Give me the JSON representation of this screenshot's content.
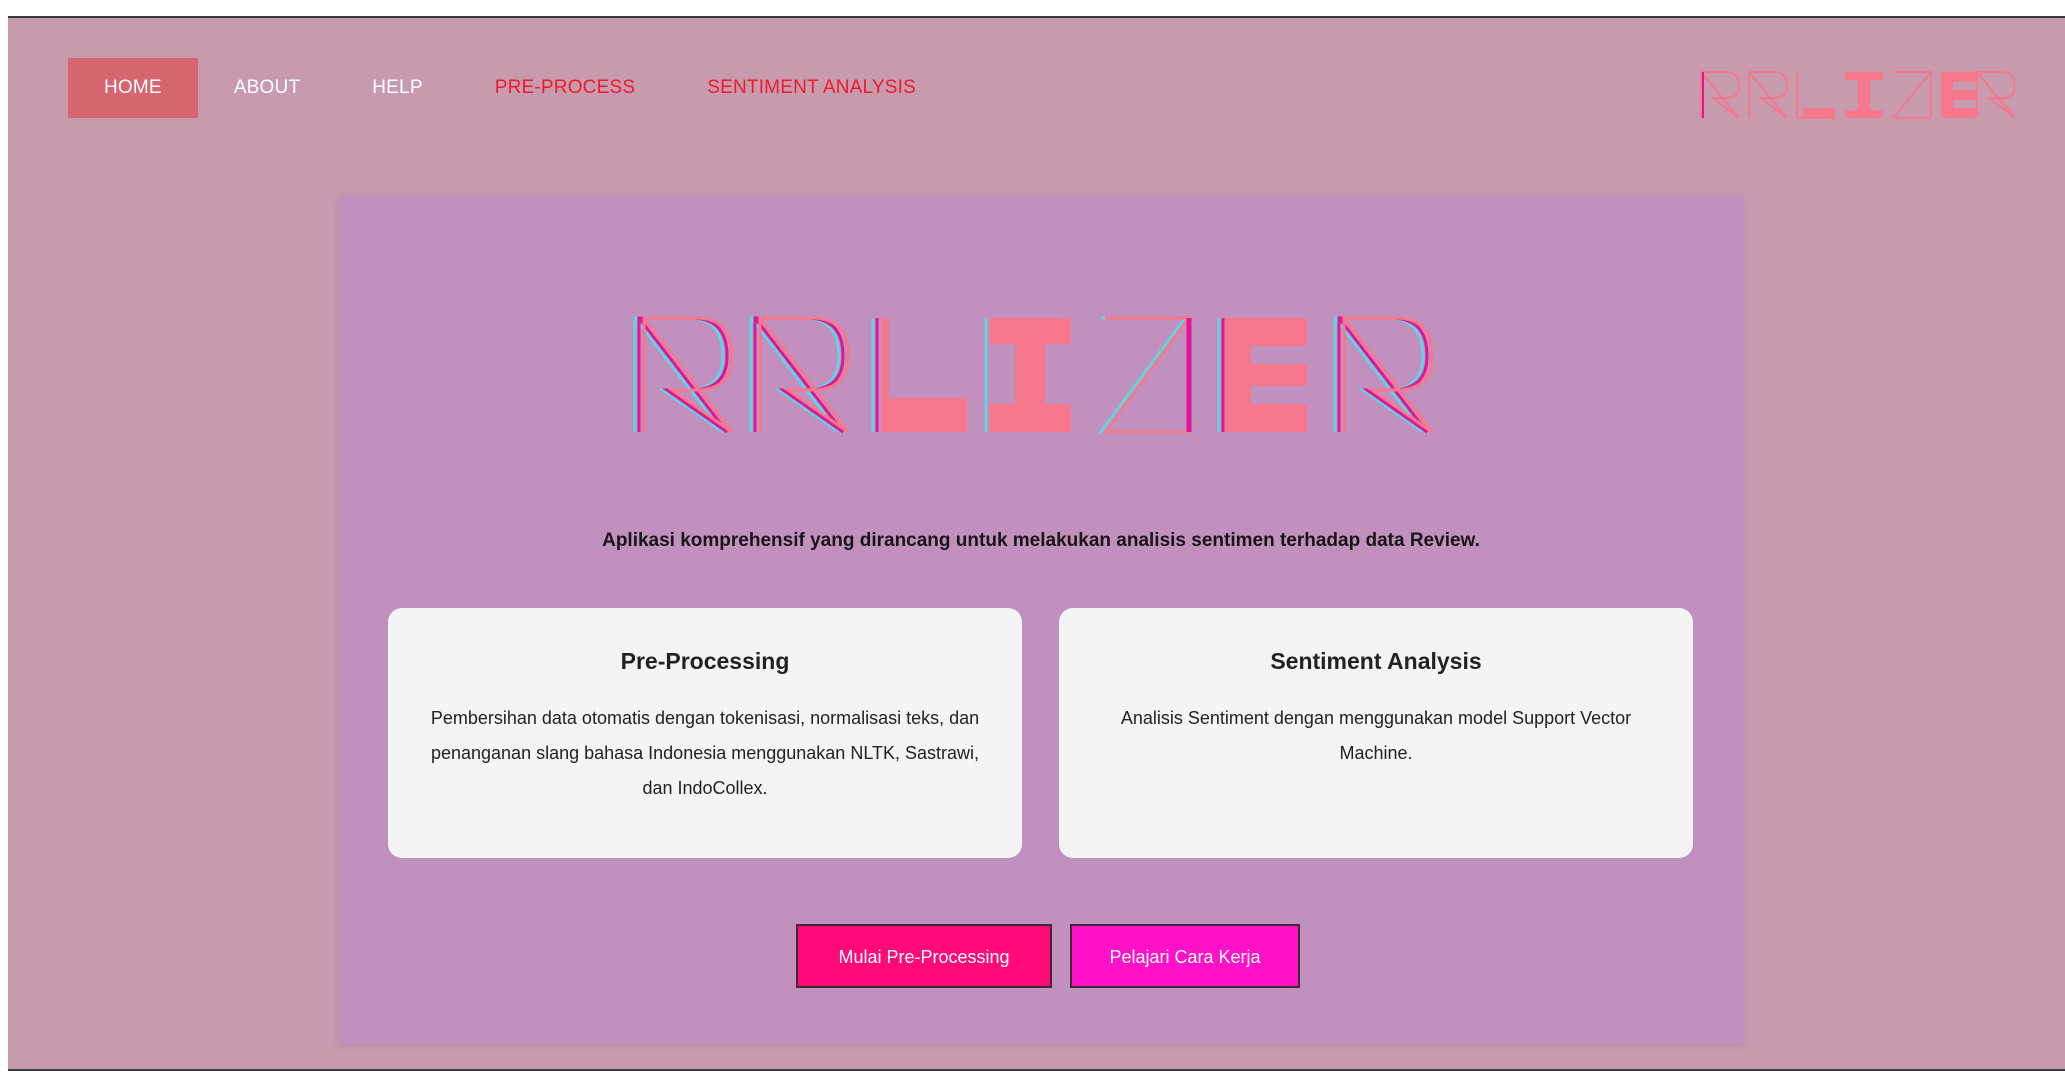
{
  "nav": {
    "items": [
      {
        "label": "HOME",
        "active": true
      },
      {
        "label": "ABOUT",
        "active": false
      },
      {
        "label": "HELP",
        "active": false
      },
      {
        "label": "PRE-PROCESS",
        "active": false
      },
      {
        "label": "SENTIMENT ANALYSIS",
        "active": false
      }
    ]
  },
  "brand": {
    "logo_text": "RRLIZER",
    "logo_colors": {
      "outline_pink": "#f6788c",
      "outline_cyan": "#5ed5df",
      "outline_magenta": "#e3149b"
    }
  },
  "hero": {
    "tagline": "Aplikasi komprehensif yang dirancang untuk melakukan analisis sentimen terhadap data Review."
  },
  "cards": [
    {
      "title": "Pre-Processing",
      "body": "Pembersihan data otomatis dengan tokenisasi, normalisasi teks, dan penanganan slang bahasa Indonesia menggunakan NLTK, Sastrawi, dan IndoCollex."
    },
    {
      "title": "Sentiment Analysis",
      "body": "Analisis Sentiment dengan menggunakan model Support Vector Machine."
    }
  ],
  "buttons": {
    "primary_label": "Mulai Pre-Processing",
    "secondary_label": "Pelajari Cara Kerja"
  },
  "colors": {
    "page_bg": "#c89aae",
    "panel_bg": "#c290bf",
    "nav_active_bg": "#d5666f",
    "nav_red_text": "#ee1b2b",
    "card_bg": "#f4f4f4",
    "btn_primary": "#ff0a78",
    "btn_secondary": "#ff10c9"
  }
}
